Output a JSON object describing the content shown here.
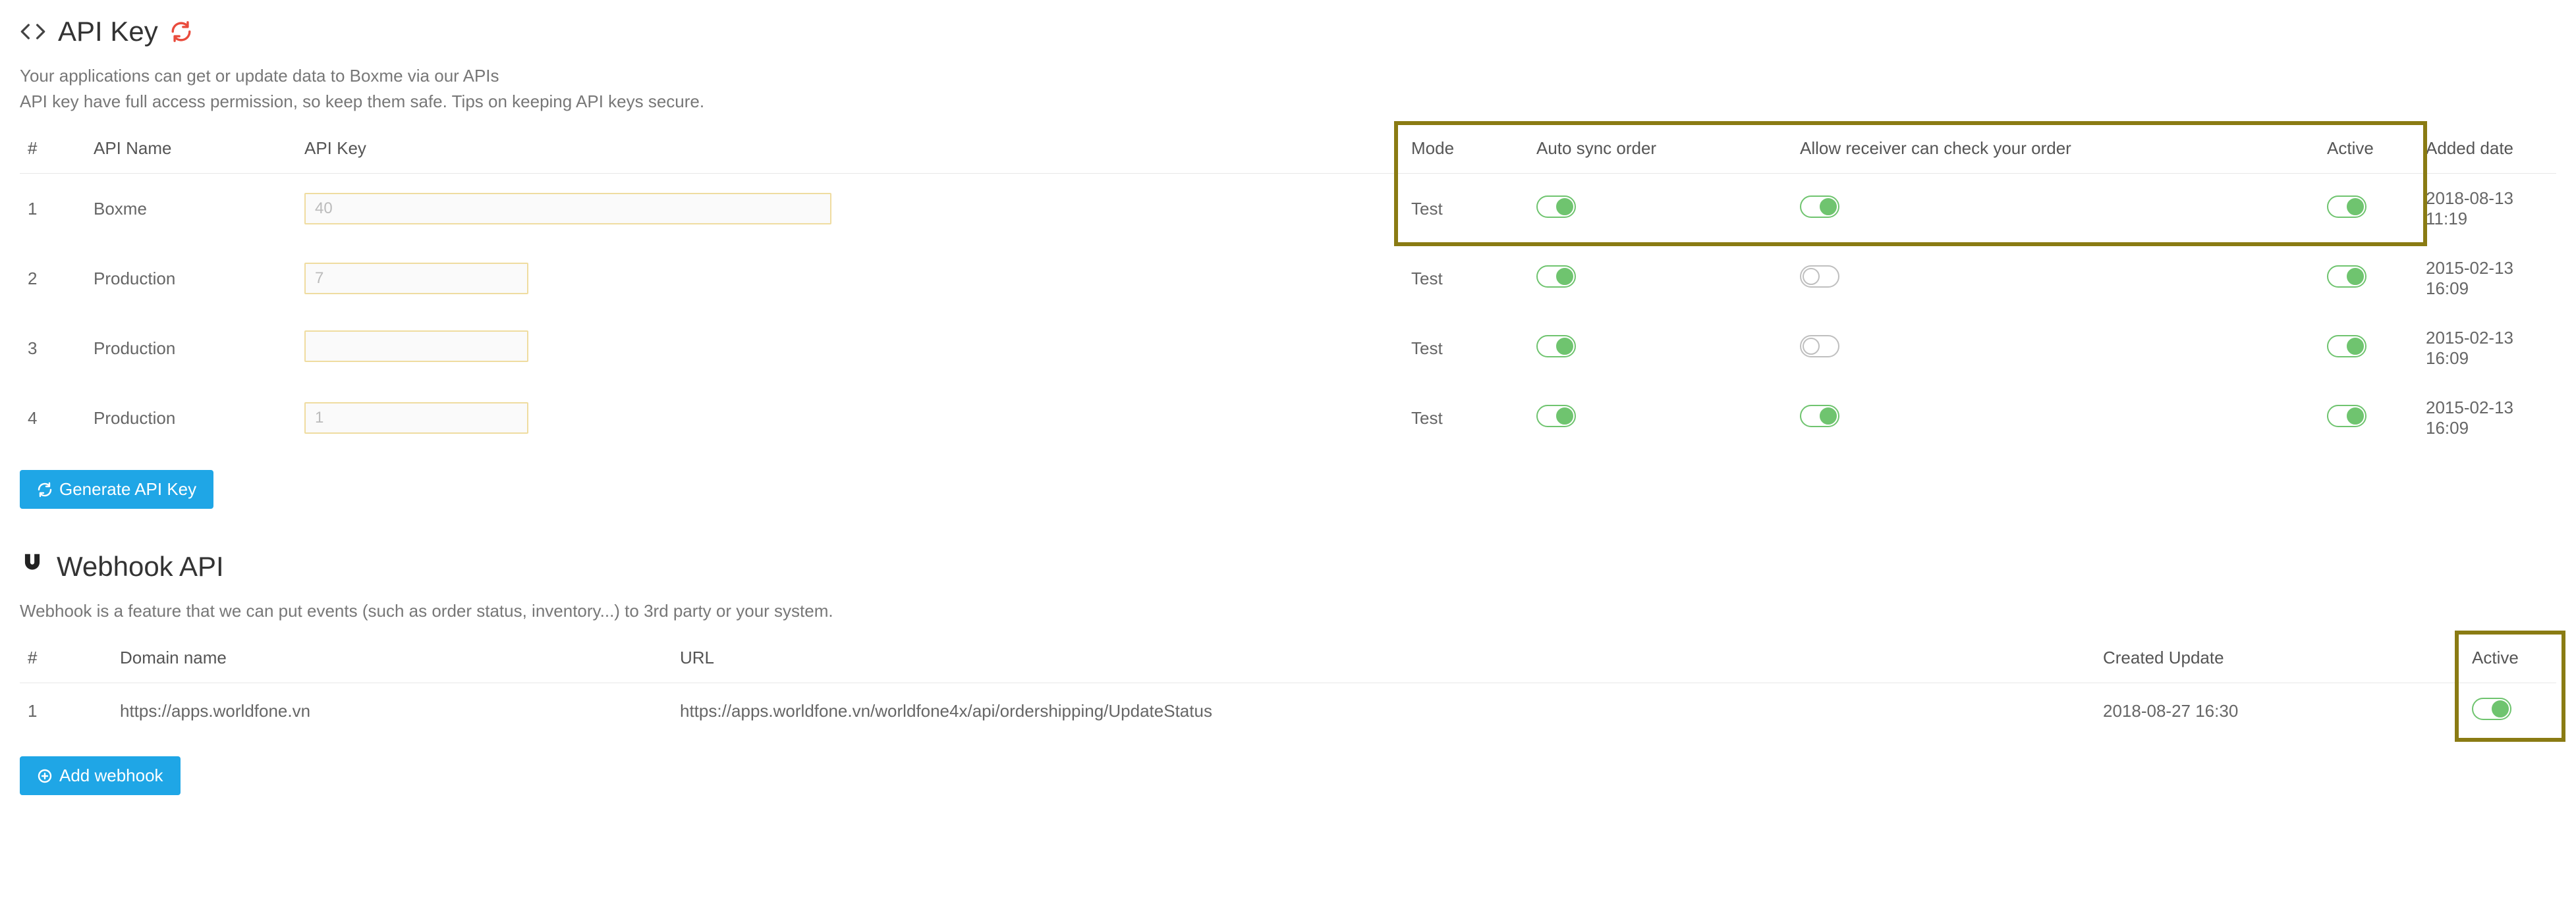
{
  "api_section": {
    "title": "API Key",
    "desc1": "Your applications can get or update data to Boxme via our APIs",
    "desc2_a": "API key have full access permission, so keep them safe. ",
    "desc2_link": "Tips on keeping API keys secure.",
    "headers": {
      "idx": "#",
      "name": "API Name",
      "key": "API Key",
      "mode": "Mode",
      "auto": "Auto sync order",
      "allow": "Allow receiver can check your order",
      "active": "Active",
      "date": "Added date"
    },
    "rows": [
      {
        "idx": "1",
        "name": "Boxme",
        "key_mask": "40",
        "key_wide": true,
        "mode": "Test",
        "auto": true,
        "allow": true,
        "active": true,
        "date": "2018-08-13 11:19"
      },
      {
        "idx": "2",
        "name": "Production",
        "key_mask": "7",
        "key_wide": false,
        "mode": "Test",
        "auto": true,
        "allow": false,
        "active": true,
        "date": "2015-02-13 16:09"
      },
      {
        "idx": "3",
        "name": "Production",
        "key_mask": "",
        "key_wide": false,
        "mode": "Test",
        "auto": true,
        "allow": false,
        "active": true,
        "date": "2015-02-13 16:09"
      },
      {
        "idx": "4",
        "name": "Production",
        "key_mask": "1",
        "key_wide": false,
        "mode": "Test",
        "auto": true,
        "allow": true,
        "active": true,
        "date": "2015-02-13 16:09"
      }
    ],
    "generate_button": "Generate API Key"
  },
  "webhook_section": {
    "title": "Webhook API",
    "desc": "Webhook is a feature that we can put events (such as order status, inventory...) to 3rd party or your system.",
    "headers": {
      "idx": "#",
      "domain": "Domain name",
      "url": "URL",
      "created": "Created Update",
      "active": "Active"
    },
    "rows": [
      {
        "idx": "1",
        "domain": "https://apps.worldfone.vn",
        "url": "https://apps.worldfone.vn/worldfone4x/api/ordershipping/UpdateStatus",
        "created": "2018-08-27 16:30",
        "active": true
      }
    ],
    "add_button": "Add webhook"
  }
}
